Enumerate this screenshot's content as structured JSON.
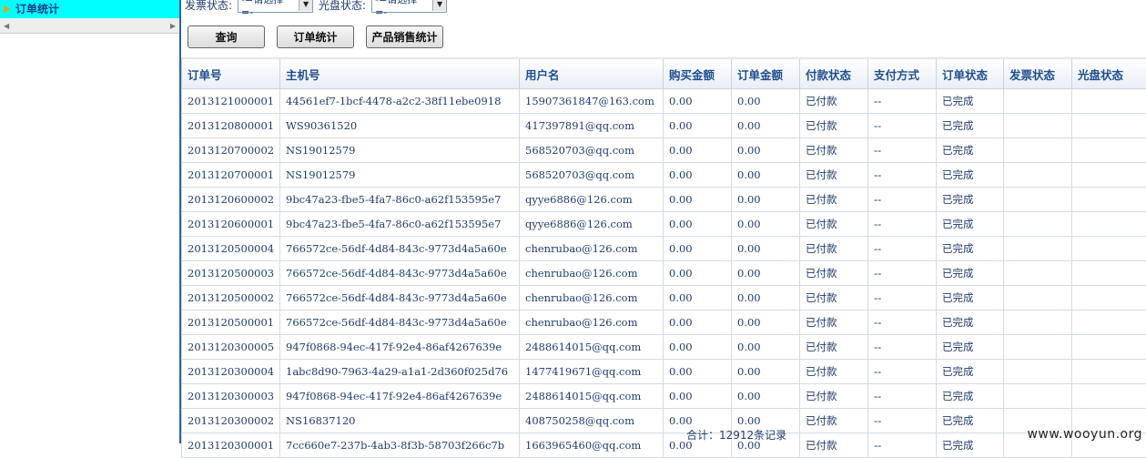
{
  "sidebar": {
    "title": "订单统计"
  },
  "filters": {
    "invoice_label": "发票状态:",
    "invoice_value": "-=请选择=-",
    "disc_label": "光盘状态:",
    "disc_value": "-=请选择=-"
  },
  "buttons": {
    "query": "查询",
    "order_stats": "订单统计",
    "product_sales": "产品销售统计"
  },
  "table": {
    "headers": [
      "订单号",
      "主机号",
      "用户名",
      "购买金额",
      "订单金额",
      "付款状态",
      "支付方式",
      "订单状态",
      "发票状态",
      "光盘状态"
    ],
    "rows": [
      [
        "2013121000001",
        "44561ef7-1bcf-4478-a2c2-38f11ebe0918",
        "15907361847@163.com",
        "0.00",
        "0.00",
        "已付款",
        "--",
        "已完成",
        "",
        ""
      ],
      [
        "2013120800001",
        "WS90361520",
        "417397891@qq.com",
        "0.00",
        "0.00",
        "已付款",
        "--",
        "已完成",
        "",
        ""
      ],
      [
        "2013120700002",
        "NS19012579",
        "568520703@qq.com",
        "0.00",
        "0.00",
        "已付款",
        "--",
        "已完成",
        "",
        ""
      ],
      [
        "2013120700001",
        "NS19012579",
        "568520703@qq.com",
        "0.00",
        "0.00",
        "已付款",
        "--",
        "已完成",
        "",
        ""
      ],
      [
        "2013120600002",
        "9bc47a23-fbe5-4fa7-86c0-a62f153595e7",
        "qyye6886@126.com",
        "0.00",
        "0.00",
        "已付款",
        "--",
        "已完成",
        "",
        ""
      ],
      [
        "2013120600001",
        "9bc47a23-fbe5-4fa7-86c0-a62f153595e7",
        "qyye6886@126.com",
        "0.00",
        "0.00",
        "已付款",
        "--",
        "已完成",
        "",
        ""
      ],
      [
        "2013120500004",
        "766572ce-56df-4d84-843c-9773d4a5a60e",
        "chenrubao@126.com",
        "0.00",
        "0.00",
        "已付款",
        "--",
        "已完成",
        "",
        ""
      ],
      [
        "2013120500003",
        "766572ce-56df-4d84-843c-9773d4a5a60e",
        "chenrubao@126.com",
        "0.00",
        "0.00",
        "已付款",
        "--",
        "已完成",
        "",
        ""
      ],
      [
        "2013120500002",
        "766572ce-56df-4d84-843c-9773d4a5a60e",
        "chenrubao@126.com",
        "0.00",
        "0.00",
        "已付款",
        "--",
        "已完成",
        "",
        ""
      ],
      [
        "2013120500001",
        "766572ce-56df-4d84-843c-9773d4a5a60e",
        "chenrubao@126.com",
        "0.00",
        "0.00",
        "已付款",
        "--",
        "已完成",
        "",
        ""
      ],
      [
        "2013120300005",
        "947f0868-94ec-417f-92e4-86af4267639e",
        "2488614015@qq.com",
        "0.00",
        "0.00",
        "已付款",
        "--",
        "已完成",
        "",
        ""
      ],
      [
        "2013120300004",
        "1abc8d90-7963-4a29-a1a1-2d360f025d76",
        "1477419671@qq.com",
        "0.00",
        "0.00",
        "已付款",
        "--",
        "已完成",
        "",
        ""
      ],
      [
        "2013120300003",
        "947f0868-94ec-417f-92e4-86af4267639e",
        "2488614015@qq.com",
        "0.00",
        "0.00",
        "已付款",
        "--",
        "已完成",
        "",
        ""
      ],
      [
        "2013120300002",
        "NS16837120",
        "408750258@qq.com",
        "0.00",
        "0.00",
        "已付款",
        "--",
        "已完成",
        "",
        ""
      ],
      [
        "2013120300001",
        "7cc660e7-237b-4ab3-8f3b-58703f266c7b",
        "1663965460@qq.com",
        "0.00",
        "0.00",
        "已付款",
        "--",
        "已完成",
        "",
        ""
      ]
    ]
  },
  "footer": {
    "total": "合计：12912条记录",
    "watermark": "www.wooyun.org"
  }
}
